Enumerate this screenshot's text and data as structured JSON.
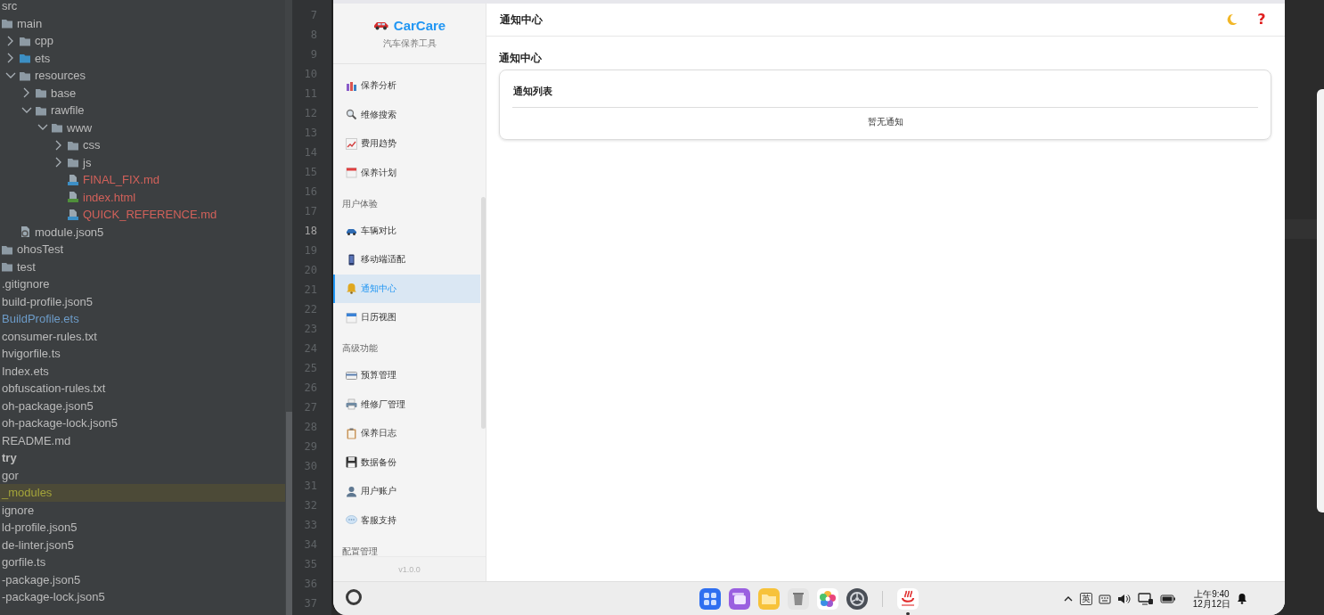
{
  "ide": {
    "project_tree": [
      {
        "label": "src",
        "kind": "folder",
        "color": "#bbbbbb",
        "selected": false,
        "children": [
          {
            "label": "main",
            "kind": "folder",
            "color": "#bbbbbb",
            "selected": false,
            "children": [
              {
                "label": "cpp",
                "kind": "folder",
                "color": "#bbbbbb",
                "selected": false,
                "expanded": false
              },
              {
                "label": "ets",
                "kind": "source-folder",
                "color": "#bbbbbb",
                "selected": false,
                "expanded": false
              },
              {
                "label": "resources",
                "kind": "folder",
                "color": "#bbbbbb",
                "selected": false,
                "expanded": true,
                "children": [
                  {
                    "label": "base",
                    "kind": "folder",
                    "color": "#bbbbbb",
                    "selected": false,
                    "expanded": false
                  },
                  {
                    "label": "rawfile",
                    "kind": "folder",
                    "color": "#bbbbbb",
                    "selected": false,
                    "expanded": true,
                    "children": [
                      {
                        "label": "www",
                        "kind": "folder",
                        "color": "#bbbbbb",
                        "selected": false,
                        "expanded": true,
                        "children": [
                          {
                            "label": "css",
                            "kind": "folder",
                            "color": "#bbbbbb",
                            "selected": false,
                            "expanded": false
                          },
                          {
                            "label": "js",
                            "kind": "folder",
                            "color": "#bbbbbb",
                            "selected": false,
                            "expanded": false
                          },
                          {
                            "label": "FINAL_FIX.md",
                            "kind": "md-file",
                            "color": "#d2615a",
                            "selected": false
                          },
                          {
                            "label": "index.html",
                            "kind": "html-file",
                            "color": "#d2615a",
                            "selected": false
                          },
                          {
                            "label": "QUICK_REFERENCE.md",
                            "kind": "md-file",
                            "color": "#d2615a",
                            "selected": false
                          }
                        ]
                      }
                    ]
                  }
                ]
              },
              {
                "label": "module.json5",
                "kind": "module-file",
                "color": "#bbbbbb",
                "selected": false
              }
            ]
          },
          {
            "label": "ohosTest",
            "kind": "folder",
            "color": "#bbbbbb",
            "selected": false
          },
          {
            "label": "test",
            "kind": "folder",
            "color": "#bbbbbb",
            "selected": false
          }
        ]
      },
      {
        "label": ".gitignore",
        "kind": "file",
        "color": "#bbbbbb",
        "selected": false
      },
      {
        "label": "build-profile.json5",
        "kind": "file",
        "color": "#bbbbbb",
        "selected": false
      },
      {
        "label": "BuildProfile.ets",
        "kind": "file",
        "color": "#6d9cc9",
        "selected": false
      },
      {
        "label": "consumer-rules.txt",
        "kind": "file",
        "color": "#bbbbbb",
        "selected": false
      },
      {
        "label": "hvigorfile.ts",
        "kind": "file",
        "color": "#bbbbbb",
        "selected": false
      },
      {
        "label": "Index.ets",
        "kind": "file",
        "color": "#bbbbbb",
        "selected": false
      },
      {
        "label": "obfuscation-rules.txt",
        "kind": "file",
        "color": "#bbbbbb",
        "selected": false
      },
      {
        "label": "oh-package.json5",
        "kind": "file",
        "color": "#bbbbbb",
        "selected": false
      },
      {
        "label": "oh-package-lock.json5",
        "kind": "file",
        "color": "#bbbbbb",
        "selected": false
      },
      {
        "label": "README.md",
        "kind": "file",
        "color": "#bbbbbb",
        "selected": false
      },
      {
        "label": "try",
        "kind": "module",
        "color": "#bbbbbb",
        "selected": false
      },
      {
        "label": "gor",
        "kind": "file",
        "color": "#bbbbbb",
        "selected": false
      },
      {
        "label": "_modules",
        "kind": "file",
        "color": "#a4a43a",
        "selected": true
      },
      {
        "label": "ignore",
        "kind": "file",
        "color": "#bbbbbb",
        "selected": false
      },
      {
        "label": "ld-profile.json5",
        "kind": "file",
        "color": "#bbbbbb",
        "selected": false
      },
      {
        "label": "de-linter.json5",
        "kind": "file",
        "color": "#bbbbbb",
        "selected": false
      },
      {
        "label": "gorfile.ts",
        "kind": "file",
        "color": "#bbbbbb",
        "selected": false
      },
      {
        "label": "-package.json5",
        "kind": "file",
        "color": "#bbbbbb",
        "selected": false
      },
      {
        "label": "-package-lock.json5",
        "kind": "file",
        "color": "#bbbbbb",
        "selected": false
      }
    ],
    "line_numbers": [
      {
        "number": "7",
        "current": false
      },
      {
        "number": "8",
        "current": false
      },
      {
        "number": "9",
        "current": false
      },
      {
        "number": "10",
        "current": false
      },
      {
        "number": "11",
        "current": false
      },
      {
        "number": "12",
        "current": false
      },
      {
        "number": "13",
        "current": false
      },
      {
        "number": "14",
        "current": false
      },
      {
        "number": "15",
        "current": false
      },
      {
        "number": "16",
        "current": false
      },
      {
        "number": "17",
        "current": false
      },
      {
        "number": "18",
        "current": true
      },
      {
        "number": "19",
        "current": false
      },
      {
        "number": "20",
        "current": false
      },
      {
        "number": "21",
        "current": false
      },
      {
        "number": "22",
        "current": false
      },
      {
        "number": "23",
        "current": false
      },
      {
        "number": "24",
        "current": false
      },
      {
        "number": "25",
        "current": false
      },
      {
        "number": "26",
        "current": false
      },
      {
        "number": "27",
        "current": false
      },
      {
        "number": "28",
        "current": false
      },
      {
        "number": "29",
        "current": false
      },
      {
        "number": "30",
        "current": false
      },
      {
        "number": "31",
        "current": false
      },
      {
        "number": "32",
        "current": false
      },
      {
        "number": "33",
        "current": false
      },
      {
        "number": "34",
        "current": false
      },
      {
        "number": "35",
        "current": false
      },
      {
        "number": "36",
        "current": false
      },
      {
        "number": "37",
        "current": false
      }
    ]
  },
  "app": {
    "brand": {
      "name": "CarCare",
      "subtitle": "汽车保养工具"
    },
    "nav": [
      {
        "kind": "item",
        "label": "保养分析",
        "selected": false
      },
      {
        "kind": "item",
        "label": "维修搜索",
        "selected": false
      },
      {
        "kind": "item",
        "label": "费用趋势",
        "selected": false
      },
      {
        "kind": "item",
        "label": "保养计划",
        "selected": false
      },
      {
        "kind": "section",
        "label": "用户体验"
      },
      {
        "kind": "item",
        "label": "车辆对比",
        "selected": false
      },
      {
        "kind": "item",
        "label": "移动端适配",
        "selected": false
      },
      {
        "kind": "item",
        "label": "通知中心",
        "selected": true
      },
      {
        "kind": "item",
        "label": "日历视图",
        "selected": false
      },
      {
        "kind": "section",
        "label": "高级功能"
      },
      {
        "kind": "item",
        "label": "预算管理",
        "selected": false
      },
      {
        "kind": "item",
        "label": "维修厂管理",
        "selected": false
      },
      {
        "kind": "item",
        "label": "保养日志",
        "selected": false
      },
      {
        "kind": "item",
        "label": "数据备份",
        "selected": false
      },
      {
        "kind": "item",
        "label": "用户账户",
        "selected": false
      },
      {
        "kind": "item",
        "label": "客服支持",
        "selected": false
      },
      {
        "kind": "section",
        "label": "配置管理"
      }
    ],
    "version": "v1.0.0",
    "header": {
      "title": "通知中心",
      "help": "?"
    },
    "page_title": "通知中心",
    "card": {
      "title": "通知列表",
      "empty_text": "暂无通知"
    }
  },
  "taskbar": {
    "dock": [
      {
        "running": false
      },
      {
        "running": false
      },
      {
        "running": false
      },
      {
        "running": false
      },
      {
        "running": false
      },
      {
        "running": false
      },
      {
        "running": true
      }
    ],
    "ime": "英",
    "time": "上午9:40",
    "date": "12月12日"
  }
}
